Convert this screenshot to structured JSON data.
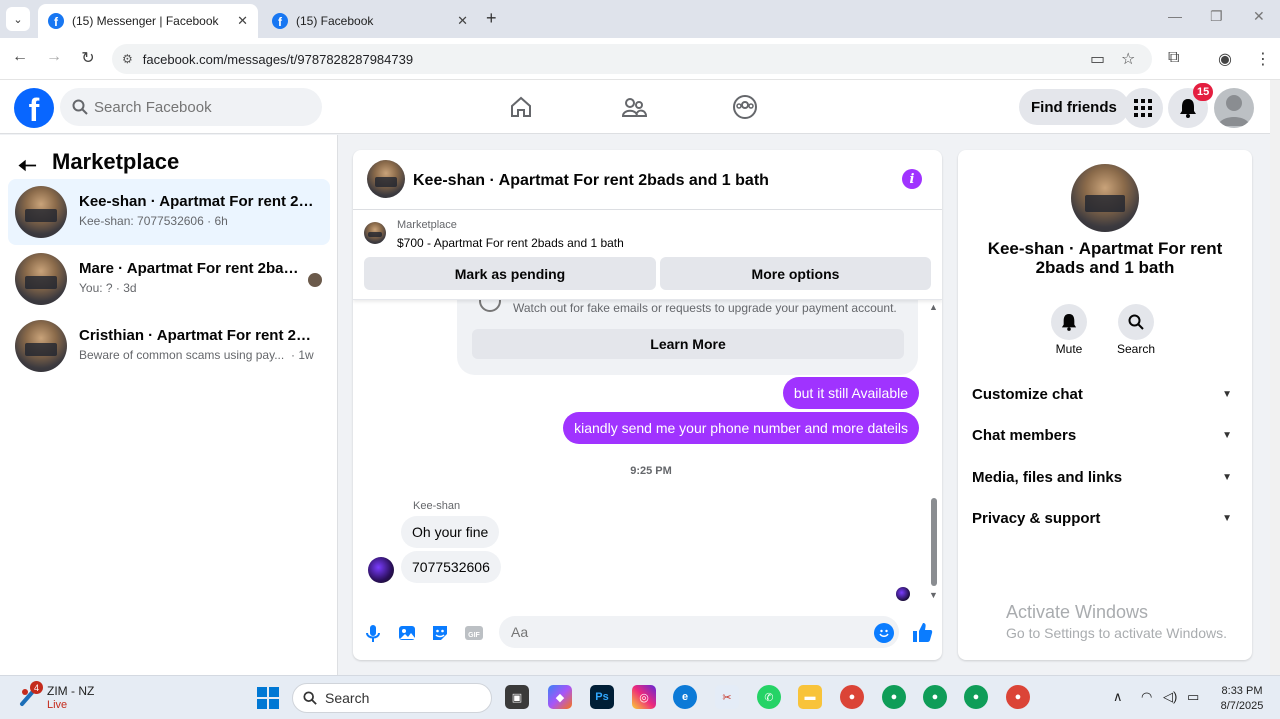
{
  "browser": {
    "tabs": [
      {
        "title": "(15) Messenger | Facebook",
        "active": true
      },
      {
        "title": "(15) Facebook",
        "active": false
      }
    ],
    "url": "facebook.com/messages/t/9787828287984739"
  },
  "fb_nav": {
    "search_placeholder": "Search Facebook",
    "find_friends": "Find friends",
    "notification_count": "15"
  },
  "sidebar": {
    "title": "Marketplace",
    "conversations": [
      {
        "name": "Kee-shan · Apartmat For rent 2bad...",
        "preview": "Kee-shan: 7077532606 · 6h",
        "selected": true
      },
      {
        "name": "Mare · Apartmat For rent 2bads ...",
        "preview": "You: ? · 3d",
        "selected": false
      },
      {
        "name": "Cristhian · Apartmat For rent 2bad...",
        "preview": "Beware of common scams using pay...",
        "time": "· 1w",
        "selected": false
      }
    ]
  },
  "chat": {
    "title": "Kee-shan · Apartmat For rent 2bads and 1 bath",
    "marketplace_label": "Marketplace",
    "listing": "$700 - Apartmat For rent 2bads and 1 bath",
    "mark_pending": "Mark as pending",
    "more_options": "More options",
    "scam_warning": "Watch out for fake emails or requests to upgrade your payment account.",
    "learn_more": "Learn More",
    "outgoing": [
      "but it still Available",
      "kiandly send me your phone number and more dateils"
    ],
    "timestamp": "9:25 PM",
    "sender": "Kee-shan",
    "incoming": [
      "Oh your fine",
      "7077532606"
    ],
    "composer_placeholder": "Aa"
  },
  "info_panel": {
    "name": "Kee-shan · Apartmat For rent 2bads and 1 bath",
    "mute": "Mute",
    "search": "Search",
    "sections": [
      "Customize chat",
      "Chat members",
      "Media, files and links",
      "Privacy & support"
    ],
    "watermark_title": "Activate Windows",
    "watermark_sub": "Go to Settings to activate Windows."
  },
  "taskbar": {
    "weather_title": "ZIM - NZ",
    "weather_sub": "Live",
    "weather_badge": "4",
    "search": "Search",
    "time": "8:33 PM",
    "date": "8/7/2025"
  },
  "colors": {
    "accent": "#a033ff",
    "fb_blue": "#0866ff",
    "badge_red": "#e41e3f"
  }
}
